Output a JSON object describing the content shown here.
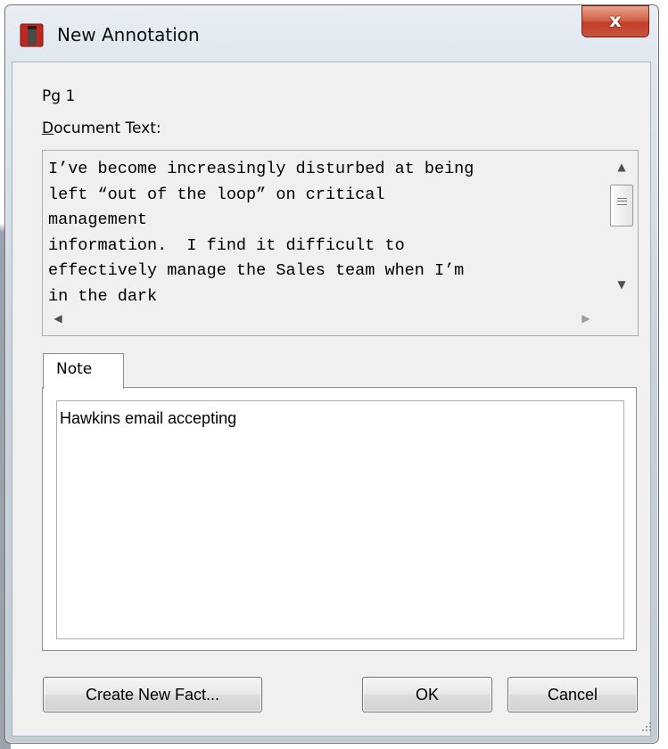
{
  "window": {
    "title": "New Annotation",
    "close_label": "x",
    "app_icon": "binder-icon"
  },
  "page_label": "Pg 1",
  "document_text": {
    "label_mnemonic": "D",
    "label_rest": "ocument Text:",
    "lines": [
      "I’ve become increasingly disturbed at being",
      "left “out of the loop” on critical",
      "management",
      "information.  I find it difficult to",
      "effectively manage the Sales team when I’m",
      "in the dark"
    ]
  },
  "tabs": [
    {
      "label": "Note",
      "selected": true
    }
  ],
  "note_text": "Hawkins email accepting",
  "buttons": {
    "create_fact": "Create New Fact...",
    "ok": "OK",
    "cancel": "Cancel"
  },
  "colors": {
    "close_button": "#c9543d",
    "app_icon": "#c0281e"
  }
}
